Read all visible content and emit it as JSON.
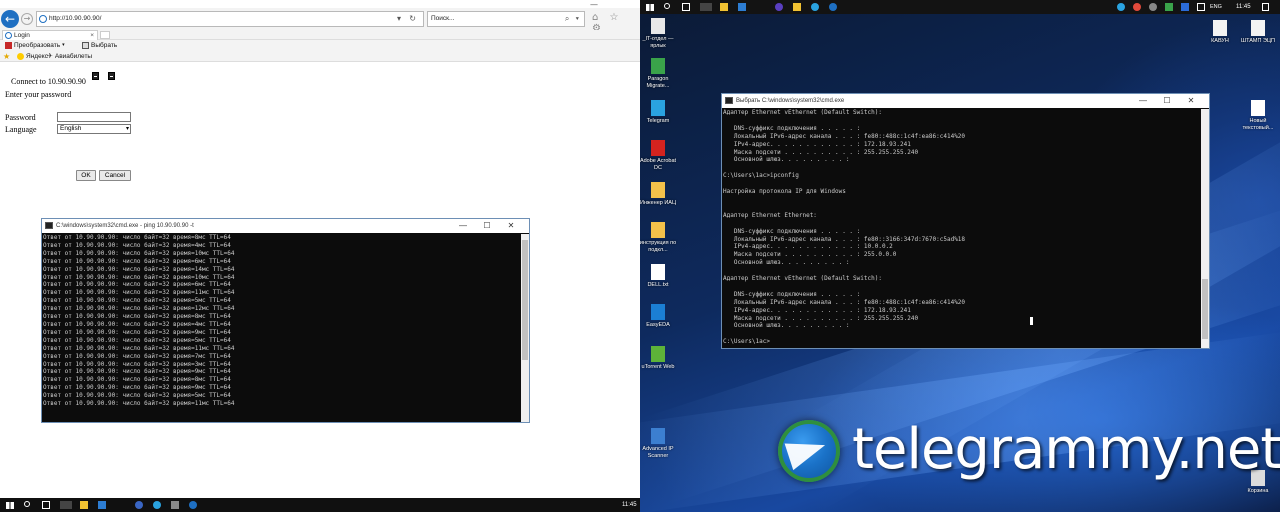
{
  "left": {
    "browser": {
      "url": "http://10.90.90.90/",
      "search_placeholder": "Поиск...",
      "tab_title": "Login",
      "cmdbar": {
        "convert": "Преобразовать",
        "select": "Выбрать"
      },
      "favorites": {
        "yandex": "Яндекс",
        "avia": "Авиабилеты"
      }
    },
    "login": {
      "connect_text": "Connect to 10.90.90.90",
      "enter_text": "Enter your password",
      "password_label": "Password",
      "password_value": "",
      "language_label": "Language",
      "language_value": "English",
      "ok_label": "OK",
      "cancel_label": "Cancel"
    },
    "ping_window": {
      "title": "C:\\windows\\system32\\cmd.exe - ping  10.90.90.90 -t",
      "lines": [
        "Ответ от 10.90.90.90: число байт=32 время=8мс TTL=64",
        "Ответ от 10.90.90.90: число байт=32 время=4мс TTL=64",
        "Ответ от 10.90.90.90: число байт=32 время=10мс TTL=64",
        "Ответ от 10.90.90.90: число байт=32 время=6мс TTL=64",
        "Ответ от 10.90.90.90: число байт=32 время=14мс TTL=64",
        "Ответ от 10.90.90.90: число байт=32 время=10мс TTL=64",
        "Ответ от 10.90.90.90: число байт=32 время=6мс TTL=64",
        "Ответ от 10.90.90.90: число байт=32 время=11мс TTL=64",
        "Ответ от 10.90.90.90: число байт=32 время=5мс TTL=64",
        "Ответ от 10.90.90.90: число байт=32 время=12мс TTL=64",
        "Ответ от 10.90.90.90: число байт=32 время=8мс TTL=64",
        "Ответ от 10.90.90.90: число байт=32 время=4мс TTL=64",
        "Ответ от 10.90.90.90: число байт=32 время=9мс TTL=64",
        "Ответ от 10.90.90.90: число байт=32 время=5мс TTL=64",
        "Ответ от 10.90.90.90: число байт=32 время=11мс TTL=64",
        "Ответ от 10.90.90.90: число байт=32 время=7мс TTL=64",
        "Ответ от 10.90.90.90: число байт=32 время=3мс TTL=64",
        "Ответ от 10.90.90.90: число байт=32 время=9мс TTL=64",
        "Ответ от 10.90.90.90: число байт=32 время=8мс TTL=64",
        "Ответ от 10.90.90.90: число байт=32 время=9мс TTL=64",
        "Ответ от 10.90.90.90: число байт=32 время=5мс TTL=64",
        "Ответ от 10.90.90.90: число байт=32 время=11мс TTL=64"
      ]
    },
    "taskbar": {
      "time": "11:45"
    }
  },
  "right": {
    "desktop_icons": [
      {
        "label": "_IT-отдел — ярлык",
        "color": "#e8e8e8"
      },
      {
        "label": "Paragon Migrate...",
        "color": "#3aa34a"
      },
      {
        "label": "Telegram",
        "color": "#2aa3e0"
      },
      {
        "label": "Adobe Acrobat DC",
        "color": "#d4231f"
      },
      {
        "label": "Инженер ИАЦ",
        "color": "#f3c14a"
      },
      {
        "label": "инструкция по подкл...",
        "color": "#f3c14a"
      },
      {
        "label": "DELL.txt",
        "color": "#ffffff"
      },
      {
        "label": "EasyEDA",
        "color": "#1b7fd4"
      },
      {
        "label": "uTorrent Web",
        "color": "#5db339"
      },
      {
        "label": "Advanced IP Scanner",
        "color": "#3c7fd0"
      }
    ],
    "right_icons": [
      {
        "label": "КАВУН",
        "color": "#f3f3f3"
      },
      {
        "label": "ШТАМП ЭЦП",
        "color": "#f3f3f3"
      },
      {
        "label": "Новый текстовый...",
        "color": "#ffffff"
      },
      {
        "label": "Корзина",
        "color": "#dcdcdc"
      }
    ],
    "ipconfig_window": {
      "title": "Выбрать C:\\windows\\system32\\cmd.exe",
      "lines": [
        "Адаптер Ethernet vEthernet (Default Switch):",
        "",
        "   DNS-суффикс подключения . . . . . :",
        "   Локальный IPv6-адрес канала . . . : fe80::488c:1c4f:ea86:c414%20",
        "   IPv4-адрес. . . . . . . . . . . . : 172.18.93.241",
        "   Маска подсети . . . . . . . . . . : 255.255.255.240",
        "   Основной шлюз. . . . . . . . . :",
        "",
        "C:\\Users\\1ac>ipconfig",
        "",
        "Настройка протокола IP для Windows",
        "",
        "",
        "Адаптер Ethernet Ethernet:",
        "",
        "   DNS-суффикс подключения . . . . . :",
        "   Локальный IPv6-адрес канала . . . : fe80::3166:347d:7670:c5ad%18",
        "   IPv4-адрес. . . . . . . . . . . . : 10.0.0.2",
        "   Маска подсети . . . . . . . . . . : 255.0.0.0",
        "   Основной шлюз. . . . . . . . . :",
        "",
        "Адаптер Ethernet vEthernet (Default Switch):",
        "",
        "   DNS-суффикс подключения . . . . . :",
        "   Локальный IPv6-адрес канала . . . : fe80::488c:1c4f:ea86:c414%20",
        "   IPv4-адрес. . . . . . . . . . . . : 172.18.93.241",
        "   Маска подсети . . . . . . . . . . : 255.255.255.240",
        "   Основной шлюз. . . . . . . . . :",
        "",
        "C:\\Users\\1ac>"
      ]
    },
    "tray": {
      "lang": "ENG",
      "time": "11:45"
    },
    "watermark": "telegrammy.net"
  }
}
